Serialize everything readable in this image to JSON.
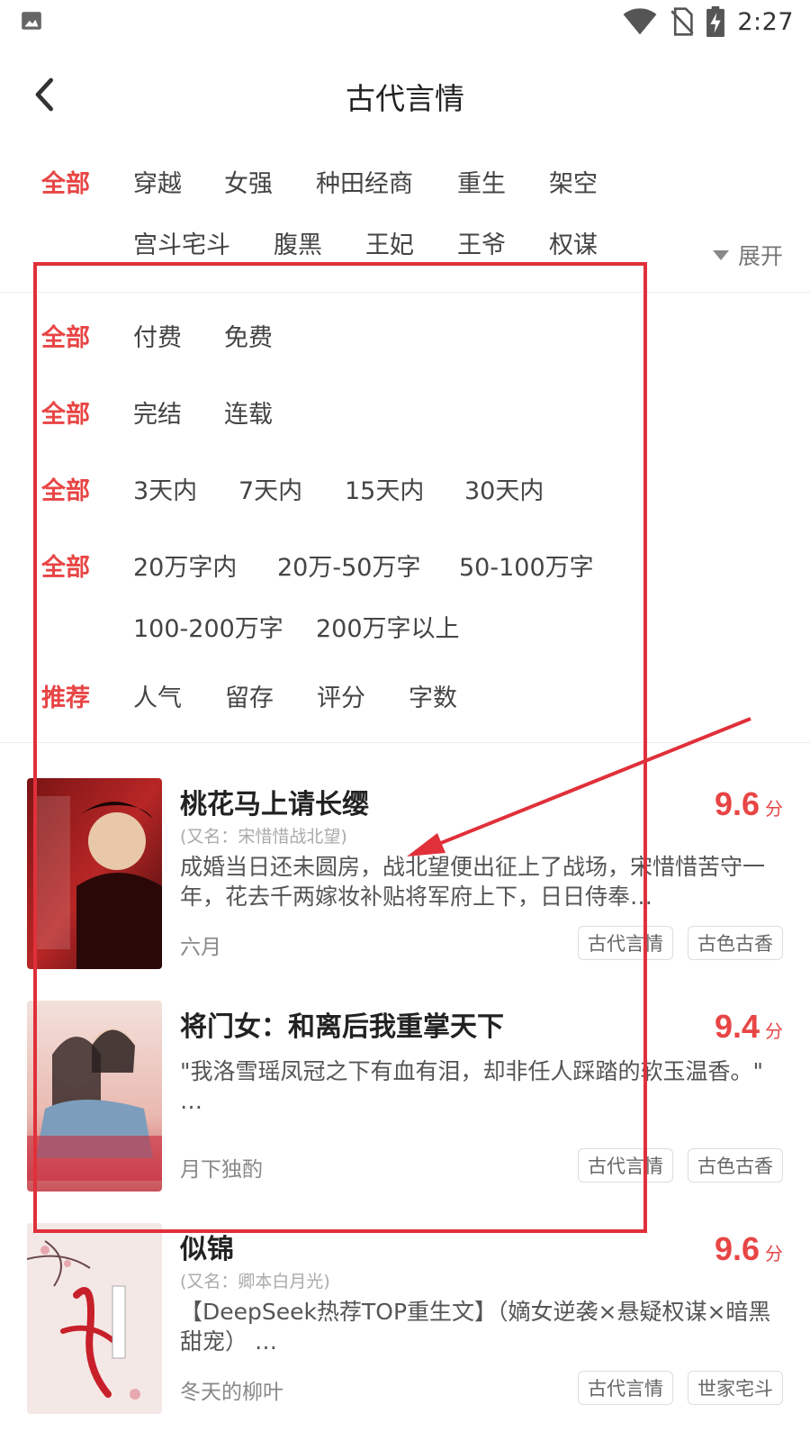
{
  "status_bar": {
    "time": "2:27",
    "icons": [
      "image-icon",
      "wifi-icon",
      "no-sim-icon",
      "battery-charging-icon"
    ]
  },
  "header": {
    "title": "古代言情",
    "back_icon": "chevron-left-icon"
  },
  "filters": {
    "category": {
      "all": "全部",
      "row1": [
        "穿越",
        "女强",
        "种田经商",
        "重生",
        "架空"
      ],
      "row2": [
        "宫斗宅斗",
        "腹黑",
        "王妃",
        "王爷",
        "权谋"
      ],
      "expand": "展开"
    },
    "price": {
      "all": "全部",
      "options": [
        "付费",
        "免费"
      ]
    },
    "status": {
      "all": "全部",
      "options": [
        "完结",
        "连载"
      ]
    },
    "update": {
      "all": "全部",
      "options": [
        "3天内",
        "7天内",
        "15天内",
        "30天内"
      ]
    },
    "length": {
      "all": "全部",
      "row1": [
        "20万字内",
        "20万-50万字",
        "50-100万字"
      ],
      "row2": [
        "100-200万字",
        "200万字以上"
      ]
    },
    "sort": {
      "active": "推荐",
      "options": [
        "人气",
        "留存",
        "评分",
        "字数"
      ]
    }
  },
  "books": [
    {
      "title": "桃花马上请长缨",
      "alias": "(又名：宋惜惜战北望)",
      "description": "成婚当日还未圆房，战北望便出征上了战场，宋惜惜苦守一年，花去千两嫁妆补贴将军府上下，日日侍奉…",
      "author": "六月",
      "score": "9.6",
      "score_unit": "分",
      "tags": [
        "古代言情",
        "古色古香"
      ]
    },
    {
      "title": "将门女：和离后我重掌天下",
      "alias": "",
      "description": "\"我洛雪瑶凤冠之下有血有泪，却非任人踩踏的软玉温香。\" …",
      "author": "月下独酌",
      "score": "9.4",
      "score_unit": "分",
      "tags": [
        "古代言情",
        "古色古香"
      ]
    },
    {
      "title": "似锦",
      "alias": "(又名：卿本白月光)",
      "description": "【DeepSeek热荐TOP重生文】（嫡女逆袭×悬疑权谋×暗黑甜宠） …",
      "author": "冬天的柳叶",
      "score": "9.6",
      "score_unit": "分",
      "tags": [
        "古代言情",
        "世家宅斗"
      ]
    }
  ],
  "colors": {
    "accent": "#e84545",
    "annotation": "#e0303a"
  }
}
